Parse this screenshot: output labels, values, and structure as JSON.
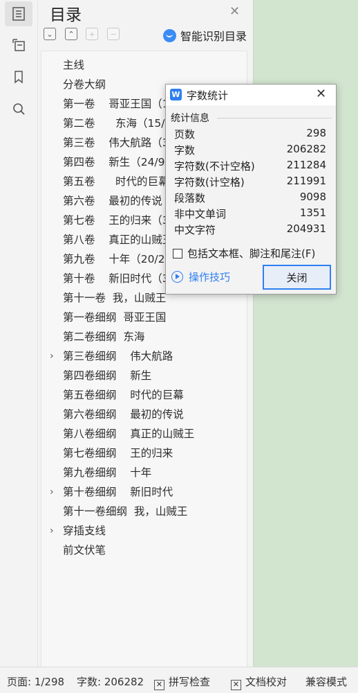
{
  "panel": {
    "title": "目录",
    "smart_label": "智能识别目录",
    "items": [
      {
        "text": "主线",
        "chev": ""
      },
      {
        "text": "分卷大纲",
        "chev": ""
      },
      {
        "text": "第一卷    哥亚王国（14",
        "chev": ""
      },
      {
        "text": "第二卷      东海（15/2",
        "chev": ""
      },
      {
        "text": "第三卷    伟大航路（38",
        "chev": ""
      },
      {
        "text": "第四卷    新生（24/91",
        "chev": ""
      },
      {
        "text": "第五卷      时代的巨幕",
        "chev": ""
      },
      {
        "text": "第六卷    最初的传说",
        "chev": ""
      },
      {
        "text": "第七卷    王的归来（30",
        "chev": ""
      },
      {
        "text": "第八卷    真正的山贼王",
        "chev": ""
      },
      {
        "text": "第九卷    十年（20/23",
        "chev": ""
      },
      {
        "text": "第十卷    新旧时代（39",
        "chev": ""
      },
      {
        "text": "第十一卷  我，山贼王",
        "chev": ""
      },
      {
        "text": "第一卷细纲  哥亚王国",
        "chev": ""
      },
      {
        "text": "第二卷细纲  东海",
        "chev": ""
      },
      {
        "text": "第三卷细纲    伟大航路",
        "chev": "›"
      },
      {
        "text": "第四卷细纲    新生",
        "chev": ""
      },
      {
        "text": "第五卷细纲    时代的巨幕",
        "chev": ""
      },
      {
        "text": "第六卷细纲    最初的传说",
        "chev": ""
      },
      {
        "text": "第八卷细纲    真正的山贼王",
        "chev": ""
      },
      {
        "text": "第七卷细纲    王的归来",
        "chev": ""
      },
      {
        "text": "第九卷细纲    十年",
        "chev": ""
      },
      {
        "text": "第十卷细纲    新旧时代",
        "chev": "›"
      },
      {
        "text": "第十一卷细纲  我，山贼王",
        "chev": ""
      },
      {
        "text": "穿插支线",
        "chev": "›"
      },
      {
        "text": "前文伏笔",
        "chev": ""
      }
    ]
  },
  "dialog": {
    "title": "字数统计",
    "group_label": "统计信息",
    "stats": [
      {
        "label": "页数",
        "value": "298"
      },
      {
        "label": "字数",
        "value": "206282"
      },
      {
        "label": "字符数(不计空格)",
        "value": "211284"
      },
      {
        "label": "字符数(计空格)",
        "value": "211991"
      },
      {
        "label": "段落数",
        "value": "9098"
      },
      {
        "label": "非中文单词",
        "value": "1351"
      },
      {
        "label": "中文字符",
        "value": "204931"
      }
    ],
    "checkbox_label": "包括文本框、脚注和尾注(F)",
    "tips_label": "操作技巧",
    "close_button": "关闭"
  },
  "status": {
    "page": "页面: 1/298",
    "words": "字数: 206282",
    "spell": "拼写检查",
    "proof": "文档校对",
    "mode": "兼容模式"
  }
}
